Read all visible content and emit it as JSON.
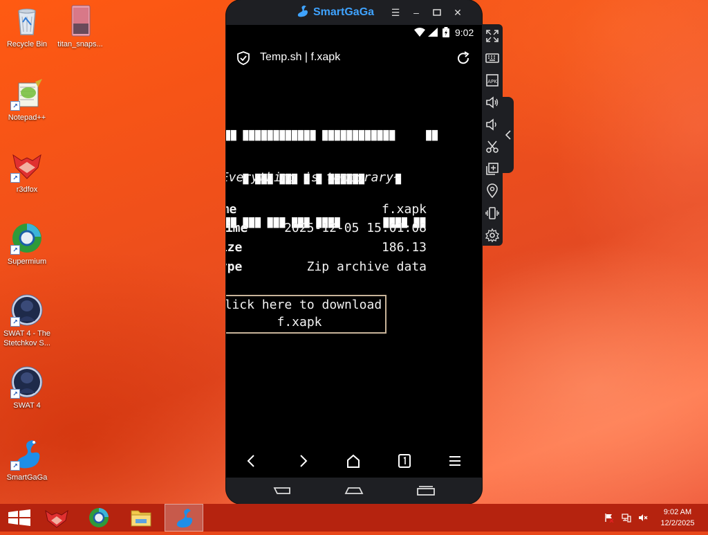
{
  "desktop": {
    "icons": [
      {
        "label": "Recycle Bin",
        "icon": "recycle-bin-icon"
      },
      {
        "label": "titan_snaps...",
        "icon": "image-file-icon"
      },
      {
        "label": "Notepad++",
        "icon": "notepad-plus-plus-icon"
      },
      {
        "label": "r3dfox",
        "icon": "r3dfox-icon"
      },
      {
        "label": "Supermium",
        "icon": "supermium-icon"
      },
      {
        "label": "SWAT 4 - The\nStetchkov S...",
        "icon": "swat4-icon"
      },
      {
        "label": "SWAT 4",
        "icon": "swat4-icon"
      },
      {
        "label": "SmartGaGa",
        "icon": "smartgaga-icon"
      }
    ]
  },
  "emulator": {
    "brand": "SmartGaGa",
    "accent": "#3fa3ff",
    "status": {
      "time": "9:02"
    },
    "browser": {
      "title": "Temp.sh | f.xapk"
    },
    "page": {
      "ascii_art": [
        "██ ████████████ ████████████     ██",
        "   █ ███ ███ █ █ ██████     █",
        "██ ███ ███ ███ ████       ████ ██"
      ],
      "tagline": "~Everything is temporary~",
      "rows": [
        {
          "key": "Name",
          "value": "f.xapk"
        },
        {
          "key": "Time",
          "value": "2025-12-05 15:01:08"
        },
        {
          "key": "Size",
          "value": "186.13"
        },
        {
          "key": "Type",
          "value": "Zip archive data"
        }
      ],
      "download_line1": "Click here to download",
      "download_line2": "f.xapk"
    }
  },
  "taskbar": {
    "items": [
      {
        "name": "start",
        "icon": "windows-start-icon"
      },
      {
        "name": "r3dfox",
        "icon": "r3dfox-icon"
      },
      {
        "name": "supermium",
        "icon": "supermium-icon"
      },
      {
        "name": "file-explorer",
        "icon": "file-explorer-icon"
      },
      {
        "name": "smartgaga",
        "icon": "smartgaga-icon",
        "active": true
      }
    ],
    "clock_time": "9:02 AM",
    "clock_date": "12/2/2025"
  }
}
